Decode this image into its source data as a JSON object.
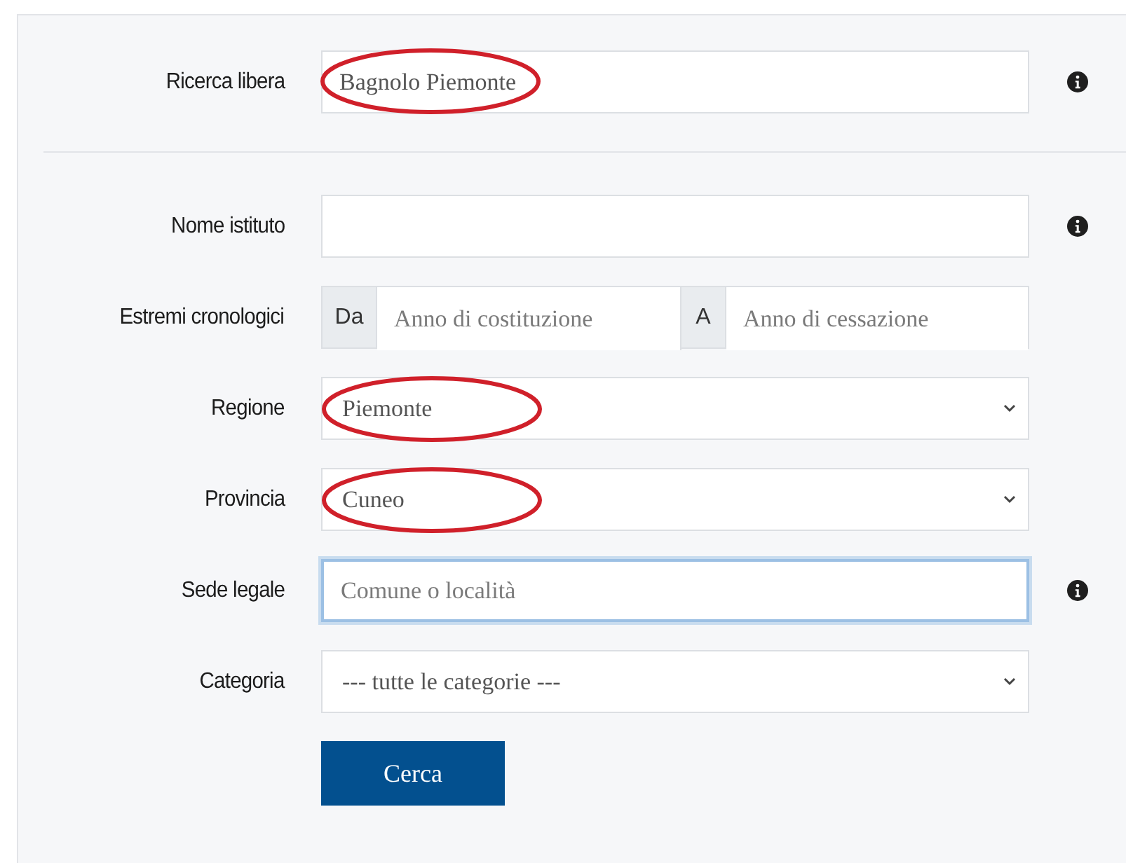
{
  "search": {
    "label": "Ricerca libera",
    "value": "Bagnolo Piemonte",
    "circled": true,
    "info": true
  },
  "fields": [
    {
      "kind": "text",
      "label": "Nome istituto",
      "info": true,
      "focused": false,
      "circled": false
    },
    {
      "kind": "range",
      "label": "Estremi cronologici",
      "from_addon": "Da",
      "from_placeholder": "Anno di costituzione",
      "to_addon": "A",
      "to_placeholder": "Anno di cessazione",
      "info": false,
      "circled": false
    },
    {
      "kind": "select",
      "label": "Regione",
      "value": "Piemonte",
      "info": false,
      "focused": false,
      "circled": true
    },
    {
      "kind": "select",
      "label": "Provincia",
      "value": "Cuneo",
      "info": false,
      "focused": false,
      "circled": true
    },
    {
      "kind": "text",
      "label": "Sede legale",
      "placeholder": "Comune o località",
      "info": true,
      "focused": true,
      "circled": false
    },
    {
      "kind": "select",
      "label": "Categoria",
      "value": "--- tutte le categorie ---",
      "info": false,
      "focused": false,
      "circled": false
    }
  ],
  "submit": "Cerca"
}
